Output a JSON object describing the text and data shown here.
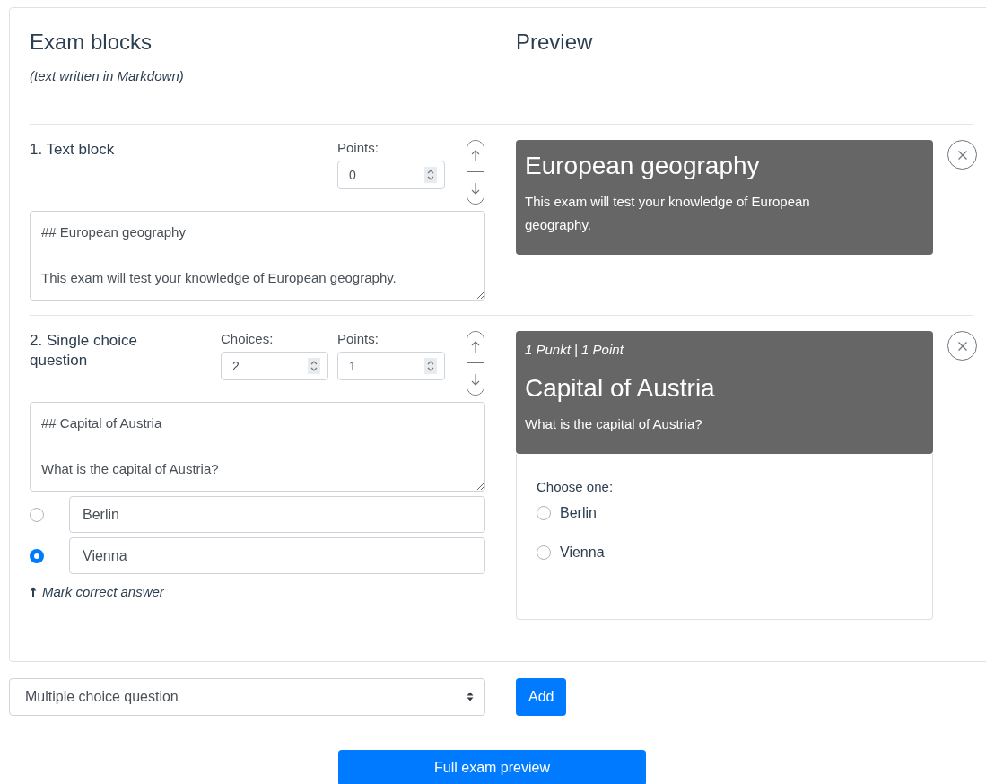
{
  "header": {
    "title": "Exam blocks",
    "subtitle": "(text written in Markdown)",
    "preview_title": "Preview"
  },
  "blocks": [
    {
      "kind": "text",
      "title": "1. Text block",
      "fields": [
        {
          "label": "Points:",
          "value": "0"
        }
      ],
      "markdown": "## European geography\n\nThis exam will test your knowledge of European geography.",
      "preview": {
        "heading": "European geography",
        "body": "This exam will test your knowledge of European geography."
      }
    },
    {
      "kind": "single_choice",
      "title": "2. Single choice question",
      "fields": [
        {
          "label": "Choices:",
          "value": "2"
        },
        {
          "label": "Points:",
          "value": "1"
        }
      ],
      "markdown": "## Capital of Austria\n\nWhat is the capital of Austria?",
      "choices": [
        {
          "text": "Berlin",
          "selected": false
        },
        {
          "text": "Vienna",
          "selected": true
        }
      ],
      "hint": "Mark correct answer",
      "preview": {
        "points": "1 Punkt | 1 Point",
        "heading": "Capital of Austria",
        "body": "What is the capital of Austria?",
        "prompt": "Choose one:",
        "options": [
          {
            "label": "Berlin",
            "selected": false
          },
          {
            "label": "Vienna",
            "selected": false
          }
        ]
      }
    }
  ],
  "footer": {
    "block_type": "Multiple choice question",
    "add": "Add",
    "full_preview": "Full exam preview"
  }
}
